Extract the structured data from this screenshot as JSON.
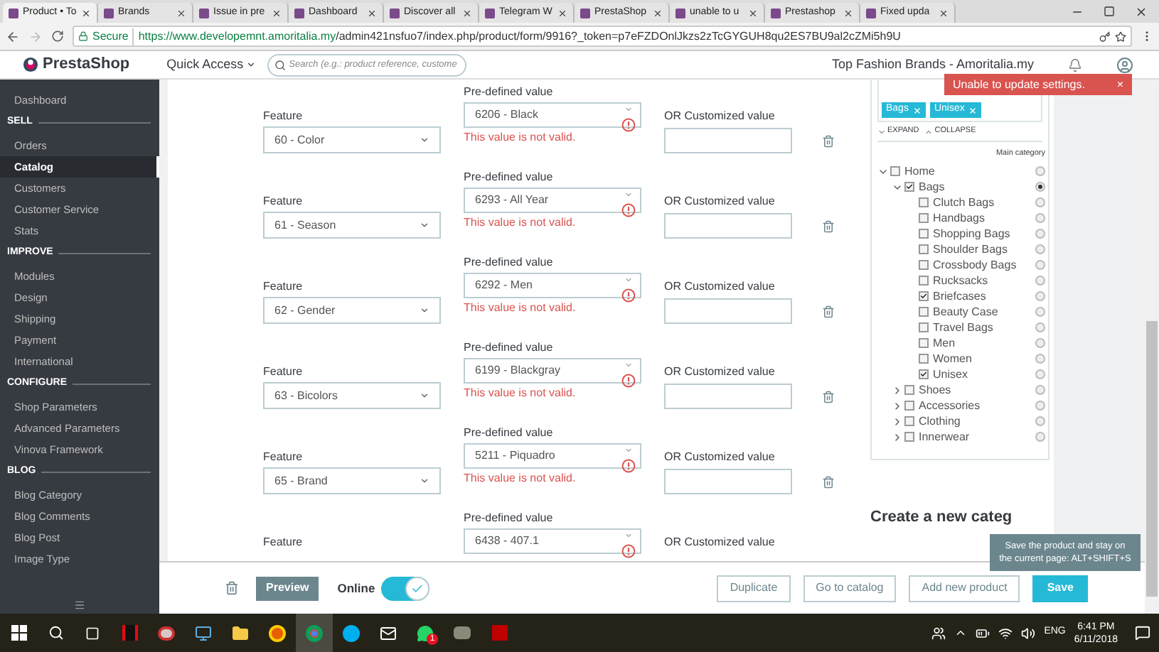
{
  "browser": {
    "tabs": [
      {
        "title": "Product • To",
        "selected": true
      },
      {
        "title": "Brands",
        "selected": false
      },
      {
        "title": "Issue in pre",
        "selected": false
      },
      {
        "title": "Dashboard",
        "selected": false
      },
      {
        "title": "Discover all",
        "selected": false
      },
      {
        "title": "Telegram W",
        "selected": false
      },
      {
        "title": "PrestaShop",
        "selected": false
      },
      {
        "title": "unable to u",
        "selected": false
      },
      {
        "title": "Prestashop",
        "selected": false
      },
      {
        "title": "Fixed upda",
        "selected": false
      }
    ],
    "secure_label": "Secure",
    "url_host": "https://www.developemnt.amoritalia.my",
    "url_path": "/admin421nsfuo7/index.php/product/form/9916?_token=p7eFZDOnlJkzs2zTcGYGUH8qu2ES7BU9al2cZMi5h9U"
  },
  "header": {
    "logo": "PrestaShop",
    "quick_access": "Quick Access",
    "search_placeholder": "Search (e.g.: product reference, custome",
    "shop_name": "Top Fashion Brands - Amoritalia.my"
  },
  "toast": {
    "message": "Unable to update settings.",
    "close": "×"
  },
  "sidebar": {
    "items": [
      {
        "kind": "item",
        "label": "Dashboard",
        "selected": false
      },
      {
        "kind": "section",
        "label": "SELL"
      },
      {
        "kind": "item",
        "label": "Orders",
        "selected": false
      },
      {
        "kind": "item",
        "label": "Catalog",
        "selected": true
      },
      {
        "kind": "item",
        "label": "Customers",
        "selected": false
      },
      {
        "kind": "item",
        "label": "Customer Service",
        "selected": false
      },
      {
        "kind": "item",
        "label": "Stats",
        "selected": false
      },
      {
        "kind": "section",
        "label": "IMPROVE"
      },
      {
        "kind": "item",
        "label": "Modules",
        "selected": false
      },
      {
        "kind": "item",
        "label": "Design",
        "selected": false
      },
      {
        "kind": "item",
        "label": "Shipping",
        "selected": false
      },
      {
        "kind": "item",
        "label": "Payment",
        "selected": false
      },
      {
        "kind": "item",
        "label": "International",
        "selected": false
      },
      {
        "kind": "section",
        "label": "CONFIGURE"
      },
      {
        "kind": "item",
        "label": "Shop Parameters",
        "selected": false
      },
      {
        "kind": "item",
        "label": "Advanced Parameters",
        "selected": false
      },
      {
        "kind": "item",
        "label": "Vinova Framework",
        "selected": false
      },
      {
        "kind": "section",
        "label": "BLOG"
      },
      {
        "kind": "item",
        "label": "Blog Category",
        "selected": false
      },
      {
        "kind": "item",
        "label": "Blog Comments",
        "selected": false
      },
      {
        "kind": "item",
        "label": "Blog Post",
        "selected": false
      },
      {
        "kind": "item",
        "label": "Image Type",
        "selected": false
      }
    ]
  },
  "features": [
    {
      "feature_label": "Feature",
      "feature_value": "60 - Color",
      "predefined_label": "Pre-defined value",
      "predefined_value": "6206 - Black",
      "error": "This value is not valid.",
      "custom_label": "OR Customized value"
    },
    {
      "feature_label": "Feature",
      "feature_value": "61 - Season",
      "predefined_label": "Pre-defined value",
      "predefined_value": "6293 - All Year",
      "error": "This value is not valid.",
      "custom_label": "OR Customized value"
    },
    {
      "feature_label": "Feature",
      "feature_value": "62 - Gender",
      "predefined_label": "Pre-defined value",
      "predefined_value": "6292 - Men",
      "error": "This value is not valid.",
      "custom_label": "OR Customized value"
    },
    {
      "feature_label": "Feature",
      "feature_value": "63 - Bicolors",
      "predefined_label": "Pre-defined value",
      "predefined_value": "6199 - Blackgray",
      "error": "This value is not valid.",
      "custom_label": "OR Customized value"
    },
    {
      "feature_label": "Feature",
      "feature_value": "65 - Brand",
      "predefined_label": "Pre-defined value",
      "predefined_value": "5211 - Piquadro",
      "error": "This value is not valid.",
      "custom_label": "OR Customized value"
    },
    {
      "feature_label": "Feature",
      "predefined_label": "Pre-defined value",
      "predefined_value": "6438 - 407.1",
      "custom_label": "OR Customized value"
    }
  ],
  "categories": {
    "tags": [
      {
        "label": "Bags"
      },
      {
        "label": "Unisex"
      }
    ],
    "expand": "EXPAND",
    "collapse": "COLLAPSE",
    "main_category_label": "Main category",
    "tree": [
      {
        "label": "Home",
        "checked": false,
        "expanded": true,
        "main": false,
        "children": [
          {
            "label": "Bags",
            "checked": true,
            "expanded": true,
            "main": true,
            "children": [
              {
                "label": "Clutch Bags",
                "checked": false,
                "main": false
              },
              {
                "label": "Handbags",
                "checked": false,
                "main": false
              },
              {
                "label": "Shopping Bags",
                "checked": false,
                "main": false
              },
              {
                "label": "Shoulder Bags",
                "checked": false,
                "main": false
              },
              {
                "label": "Crossbody Bags",
                "checked": false,
                "main": false
              },
              {
                "label": "Rucksacks",
                "checked": false,
                "main": false
              },
              {
                "label": "Briefcases",
                "checked": true,
                "main": false
              },
              {
                "label": "Beauty Case",
                "checked": false,
                "main": false
              },
              {
                "label": "Travel Bags",
                "checked": false,
                "main": false
              },
              {
                "label": "Men",
                "checked": false,
                "main": false
              },
              {
                "label": "Women",
                "checked": false,
                "main": false
              },
              {
                "label": "Unisex",
                "checked": true,
                "main": false
              }
            ]
          },
          {
            "label": "Shoes",
            "checked": false,
            "expanded": false,
            "main": false
          },
          {
            "label": "Accessories",
            "checked": false,
            "expanded": false,
            "main": false
          },
          {
            "label": "Clothing",
            "checked": false,
            "expanded": false,
            "main": false
          },
          {
            "label": "Innerwear",
            "checked": false,
            "expanded": false,
            "main": false
          }
        ]
      }
    ],
    "create_title": "Create a new categ"
  },
  "tooltip": "Save the product and stay on the current page: ALT+SHIFT+S",
  "footer": {
    "preview": "Preview",
    "online_label": "Online",
    "online": true,
    "buttons": [
      "Duplicate",
      "Go to catalog",
      "Add new product"
    ],
    "save": "Save"
  },
  "taskbar": {
    "notification_count": "1",
    "language": "ENG",
    "time": "6:41 PM",
    "date": "6/11/2018"
  }
}
